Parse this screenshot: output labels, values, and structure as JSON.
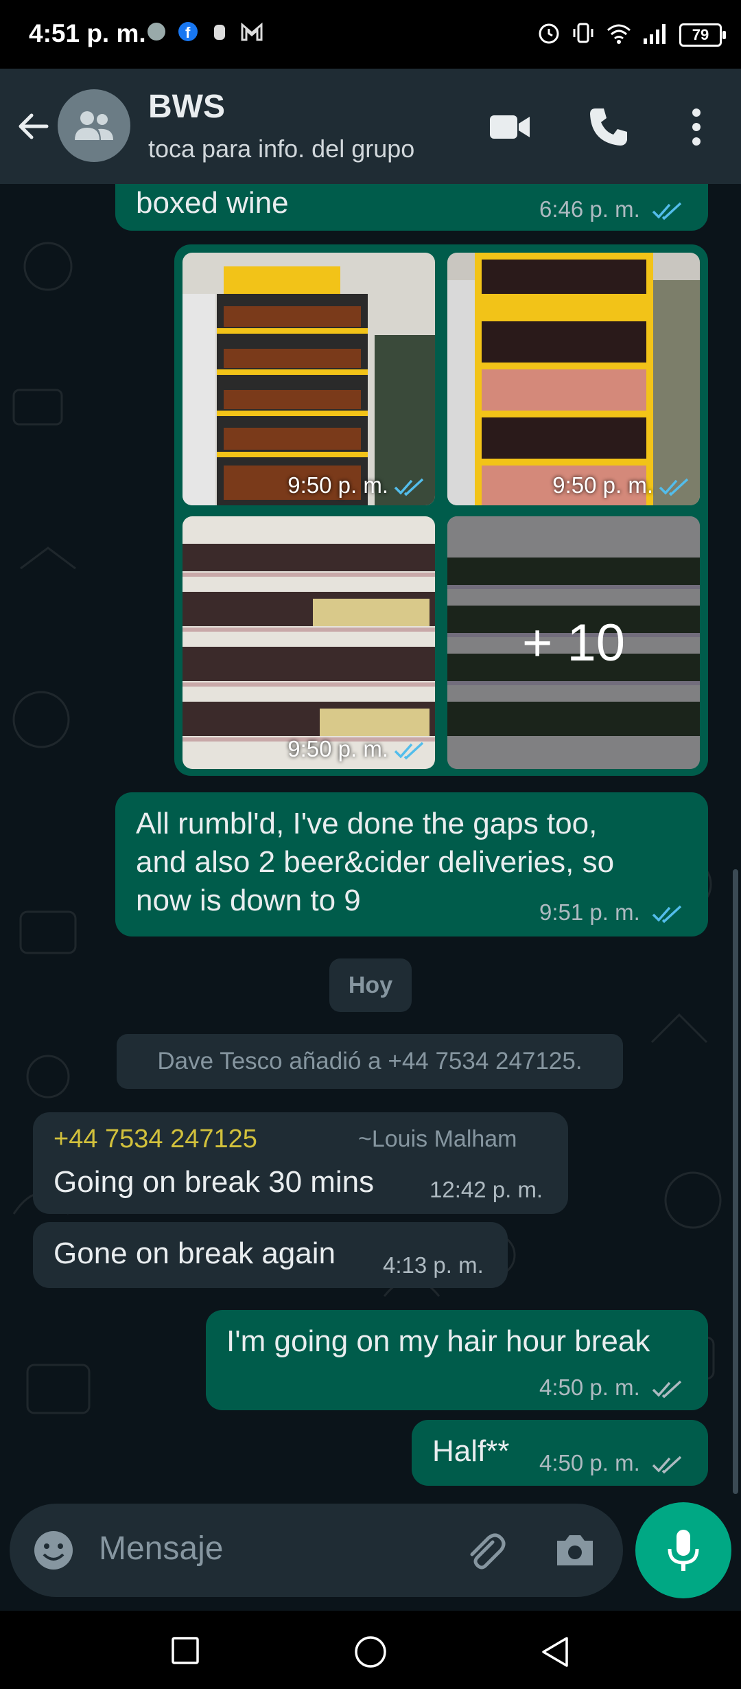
{
  "status_bar": {
    "time": "4:51 p. m.",
    "battery": "79",
    "icons": [
      "alarm-icon",
      "vibrate-icon",
      "wifi-icon",
      "signal-icon"
    ],
    "notification_icons": [
      "vpn-icon",
      "facebook-icon",
      "hand-icon",
      "gmail-icon"
    ]
  },
  "header": {
    "title": "BWS",
    "subtitle": "toca para info. del grupo",
    "icons": [
      "back-arrow-icon",
      "group-avatar-icon",
      "video-call-icon",
      "phone-icon",
      "more-options-icon"
    ]
  },
  "messages": {
    "m1": {
      "text": "boxed wine",
      "time": "6:46 p. m."
    },
    "photos": {
      "times": [
        "9:50 p. m.",
        "9:50 p. m.",
        "9:50 p. m."
      ],
      "more": "+ 10"
    },
    "m2": {
      "lines": [
        "All rumbl'd, I've done the gaps too,",
        "and also 2 beer&cider deliveries, so",
        "now is down to 9"
      ],
      "time": "9:51 p. m."
    },
    "date_chip": "Hoy",
    "system": "Dave Tesco añadió a +44 7534 247125.",
    "m3": {
      "sender": "+44 7534 247125",
      "pushname": "~Louis Malham",
      "text": "Going on break 30 mins",
      "time": "12:42 p. m."
    },
    "m4": {
      "text": "Gone on break again",
      "time": "4:13 p. m."
    },
    "m5": {
      "text": "I'm going on my hair hour break",
      "time": "4:50 p. m."
    },
    "m6": {
      "text": "Half**",
      "time": "4:50 p. m."
    }
  },
  "composer": {
    "placeholder": "Mensaje",
    "icons": [
      "emoji-icon",
      "attach-icon",
      "camera-icon",
      "mic-icon"
    ]
  },
  "colors": {
    "background": "#0b141a",
    "header": "#1f2c34",
    "outgoing_bubble": "#005c4b",
    "incoming_bubble": "#1f2c34",
    "accent": "#00a884",
    "read_ticks": "#53bdeb",
    "sender_name": "#d2c13c"
  }
}
